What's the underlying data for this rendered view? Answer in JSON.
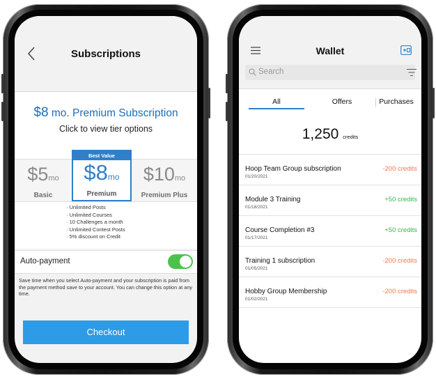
{
  "subscriptions": {
    "title": "Subscriptions",
    "headline_price": "$8",
    "headline_text": " mo. Premium Subscription",
    "subline": "Click to view tier options",
    "tiers": [
      {
        "price": "$5",
        "unit": "mo",
        "name": "Basic"
      },
      {
        "badge": "Best Value",
        "price": "$8",
        "unit": "mo",
        "name": "Premium"
      },
      {
        "price": "$10",
        "unit": "mo",
        "name": "Premium Plus"
      }
    ],
    "features": [
      "Unlimited Posts",
      "Unlimited Courses",
      "10 Challenges a month",
      "Unlimited Contest Posts",
      "5% discount on Credit"
    ],
    "auto_payment_label": "Auto-payment",
    "auto_payment_on": true,
    "auto_payment_desc": "Save time  when you select Auto-payment and your subscription is paid from the payment method save to your account. You can change this option at any time.",
    "checkout_label": "Checkout"
  },
  "wallet": {
    "title": "Wallet",
    "search_placeholder": "Search",
    "tabs": [
      "All",
      "Offers",
      "Purchases"
    ],
    "active_tab": "All",
    "balance": "1,250",
    "balance_unit": "credits",
    "transactions": [
      {
        "title": "Hoop Team Group subscription",
        "date": "01/20/2021",
        "amount": "-200 credits",
        "color": "#f07a4a"
      },
      {
        "title": "Module 3 Training",
        "date": "01/18/2021",
        "amount": "+50 credits",
        "color": "#36b34a"
      },
      {
        "title": "Course Completion #3",
        "date": "01/17/2021",
        "amount": "+50 credits",
        "color": "#36b34a"
      },
      {
        "title": "Training 1 subscription",
        "date": "01/05/2021",
        "amount": "-200 credits",
        "color": "#f07a4a"
      },
      {
        "title": "Hobby Group Membership",
        "date": "01/02/2021",
        "amount": "-200 credits",
        "color": "#f07a4a"
      }
    ]
  },
  "colors": {
    "accent_blue": "#2f80c9",
    "checkout_blue": "#2d9be6",
    "toggle_green": "#4cc24c"
  }
}
